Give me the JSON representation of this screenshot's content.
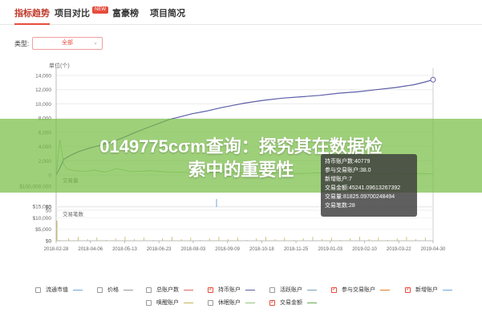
{
  "tabs": [
    {
      "label": "指标趋势",
      "active": true
    },
    {
      "label": "项目对比",
      "badge": "NEW"
    },
    {
      "label": "富豪榜"
    },
    {
      "label": "项目简况"
    }
  ],
  "filter": {
    "label": "类型:",
    "value": "全部"
  },
  "overlay_title_line1": "0149775cσm查询：探究其在数据检",
  "overlay_title_line2": "索中的重要性",
  "tooltip": {
    "lines": [
      "持币账户数:40779",
      "参与交易账户:38.0",
      "新增账户:7",
      "交易金额:45241.09613267392",
      "交易量:81825.09700248494",
      "交易笔数:28"
    ]
  },
  "legend": [
    {
      "label": "流通市值",
      "checked": false,
      "color": "#6fa8dc"
    },
    {
      "label": "价格",
      "checked": false,
      "color": "#999999"
    },
    {
      "label": "总账户数",
      "checked": false,
      "color": "#e06666"
    },
    {
      "label": "持币账户",
      "checked": true,
      "color": "#5b5ea6"
    },
    {
      "label": "活跃账户",
      "checked": false,
      "color": "#76a5af"
    },
    {
      "label": "参与交易账户",
      "checked": true,
      "color": "#e67e22"
    },
    {
      "label": "新增账户",
      "checked": true,
      "color": "#6fa8dc"
    },
    {
      "label": "唤醒账户",
      "checked": false,
      "color": "#c9b458"
    },
    {
      "label": "休眠账户",
      "checked": false,
      "color": "#93c47d"
    },
    {
      "label": "交易金额",
      "checked": true,
      "color": "#6aa84f"
    }
  ],
  "chart_data": {
    "type": "line",
    "x_ticks": [
      "2018-02-28",
      "2018-04-06",
      "2018-05-13",
      "2018-06-23",
      "2018-08-03",
      "2018-09-09",
      "2018-10-18",
      "2018-11-25",
      "2019-01-03",
      "2019-02-10",
      "2019-03-22",
      "2019-04-30"
    ],
    "panels": [
      {
        "name": "top",
        "ylabel": "单位(个)",
        "yticks": [
          "14,000",
          "12,000",
          "10,000",
          "8,000",
          "6,000",
          "4,000",
          "2,000",
          "0"
        ],
        "ylim": [
          0,
          14000
        ],
        "series": [
          {
            "color": "#5b5ea6",
            "x": [
              0,
              0.01,
              0.02,
              0.04,
              0.06,
              0.09,
              0.12,
              0.15,
              0.18,
              0.21,
              0.24,
              0.27,
              0.3,
              0.33,
              0.36,
              0.4,
              0.44,
              0.48,
              0.5,
              0.55,
              0.6,
              0.65,
              0.7,
              0.75,
              0.8,
              0.85,
              0.9,
              0.95,
              0.98,
              1.0
            ],
            "values": [
              0,
              1000,
              2200,
              2800,
              3300,
              3800,
              4200,
              4700,
              5300,
              6000,
              6600,
              7200,
              7800,
              8200,
              8600,
              9000,
              9500,
              9900,
              10100,
              10500,
              10800,
              11000,
              11200,
              11500,
              11700,
              12000,
              12300,
              12700,
              13100,
              13400
            ]
          },
          {
            "color": "#93c47d",
            "x": [
              0,
              0.01,
              0.02,
              0.03,
              0.05,
              0.08,
              0.1,
              0.13,
              0.16,
              0.2,
              0.25,
              0.3,
              0.35,
              0.4,
              0.45,
              0.5,
              0.55,
              0.6,
              0.65,
              0.7,
              0.75,
              0.8,
              0.85,
              0.9,
              0.95,
              1.0
            ],
            "values": [
              0,
              5000,
              1500,
              800,
              600,
              500,
              700,
              400,
              900,
              450,
              600,
              400,
              350,
              300,
              400,
              250,
              300,
              250,
              200,
              300,
              250,
              200,
              180,
              220,
              200,
              180
            ]
          }
        ]
      },
      {
        "name": "amount",
        "label": "交易量",
        "yticks": [
          "$100,000,000",
          "$0"
        ],
        "ylim": [
          0,
          100000000
        ]
      },
      {
        "name": "count",
        "label": "交易笔数",
        "yticks": [
          "50",
          "0"
        ],
        "ylim": [
          0,
          50
        ]
      },
      {
        "name": "bottom",
        "yticks": [
          "$15,000",
          "$10,000",
          "$5,000",
          "$0"
        ],
        "ylim": [
          0,
          15000
        ]
      }
    ]
  }
}
